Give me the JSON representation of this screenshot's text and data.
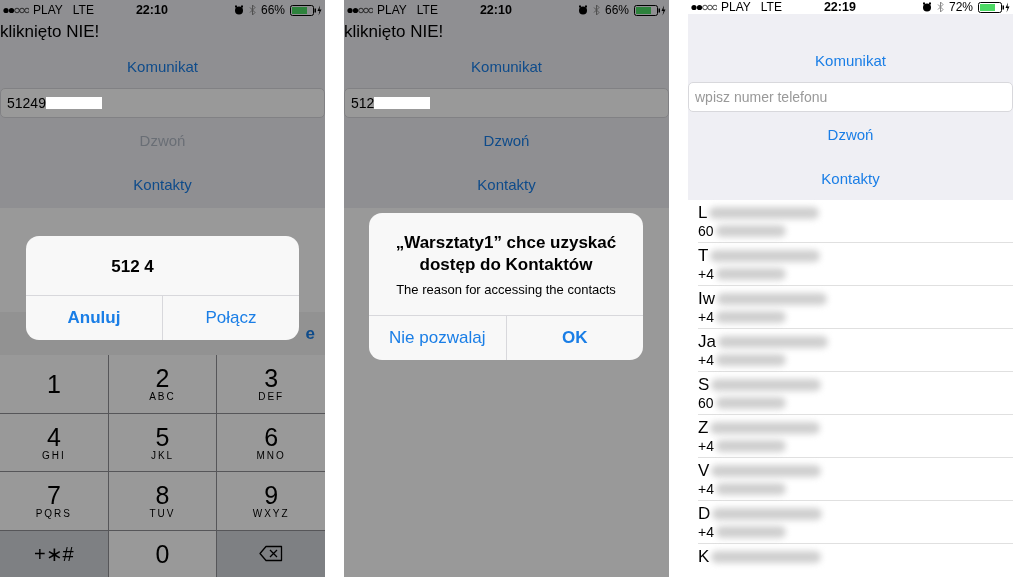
{
  "screens": [
    {
      "kind": "dialer",
      "dimmed": true,
      "status": {
        "carrier": "PLAY",
        "network": "LTE",
        "time": "22:10",
        "battery": "66%"
      },
      "message": "kliknięto NIE!",
      "komunikat": "Komunikat",
      "field": {
        "value": "51249"
      },
      "buttons": [
        {
          "label": "Dzwoń",
          "disabled": true
        },
        {
          "label": "Kontakty",
          "disabled": false
        }
      ],
      "toolbar_button": "e",
      "keys": [
        {
          "kind": "digit",
          "digit": "1"
        },
        {
          "kind": "digit",
          "digit": "2",
          "letters": "ABC"
        },
        {
          "kind": "digit",
          "digit": "3",
          "letters": "DEF"
        },
        {
          "kind": "digit",
          "digit": "4",
          "letters": "GHI"
        },
        {
          "kind": "digit",
          "digit": "5",
          "letters": "JKL"
        },
        {
          "kind": "digit",
          "digit": "6",
          "letters": "MNO"
        },
        {
          "kind": "digit",
          "digit": "7",
          "letters": "PQRS"
        },
        {
          "kind": "digit",
          "digit": "8",
          "letters": "TUV"
        },
        {
          "kind": "digit",
          "digit": "9",
          "letters": "WXYZ"
        },
        {
          "kind": "symbols",
          "digit": "+∗#"
        },
        {
          "kind": "digit",
          "digit": "0"
        },
        {
          "kind": "backspace"
        }
      ],
      "alert": {
        "title": "512 4",
        "buttons": [
          {
            "label": "Anuluj",
            "bold": true
          },
          {
            "label": "Połącz",
            "bold": false
          }
        ]
      }
    },
    {
      "kind": "permission",
      "dimmed": true,
      "status": {
        "carrier": "PLAY",
        "network": "LTE",
        "time": "22:10",
        "battery": "66%"
      },
      "message": "kliknięto NIE!",
      "komunikat": "Komunikat",
      "field": {
        "value": "512"
      },
      "buttons": [
        {
          "label": "Dzwoń",
          "disabled": false
        },
        {
          "label": "Kontakty",
          "disabled": false
        }
      ],
      "alert": {
        "title": "„Warsztaty1” chce uzyskać dostęp do Kontaktów",
        "text": "The reason for accessing the contacts",
        "buttons": [
          {
            "label": "Nie pozwalaj",
            "bold": false
          },
          {
            "label": "OK",
            "bold": true
          }
        ]
      }
    },
    {
      "kind": "contacts",
      "status": {
        "carrier": "PLAY",
        "network": "LTE",
        "time": "22:19",
        "battery": "72%"
      },
      "komunikat": "Komunikat",
      "field": {
        "placeholder": "wpisz numer telefonu"
      },
      "buttons": [
        {
          "label": "Dzwoń",
          "disabled": false
        },
        {
          "label": "Kontakty",
          "disabled": false
        }
      ],
      "contacts": [
        {
          "name": "L",
          "phone": "60"
        },
        {
          "name": "T",
          "phone": "+4"
        },
        {
          "name": "Iw",
          "phone": "+4"
        },
        {
          "name": "Ja",
          "phone": "+4"
        },
        {
          "name": "S",
          "phone": "60"
        },
        {
          "name": "Z",
          "phone": "+4"
        },
        {
          "name": "V",
          "phone": "+4"
        },
        {
          "name": "D",
          "phone": "+4"
        },
        {
          "name": "K"
        }
      ]
    }
  ]
}
